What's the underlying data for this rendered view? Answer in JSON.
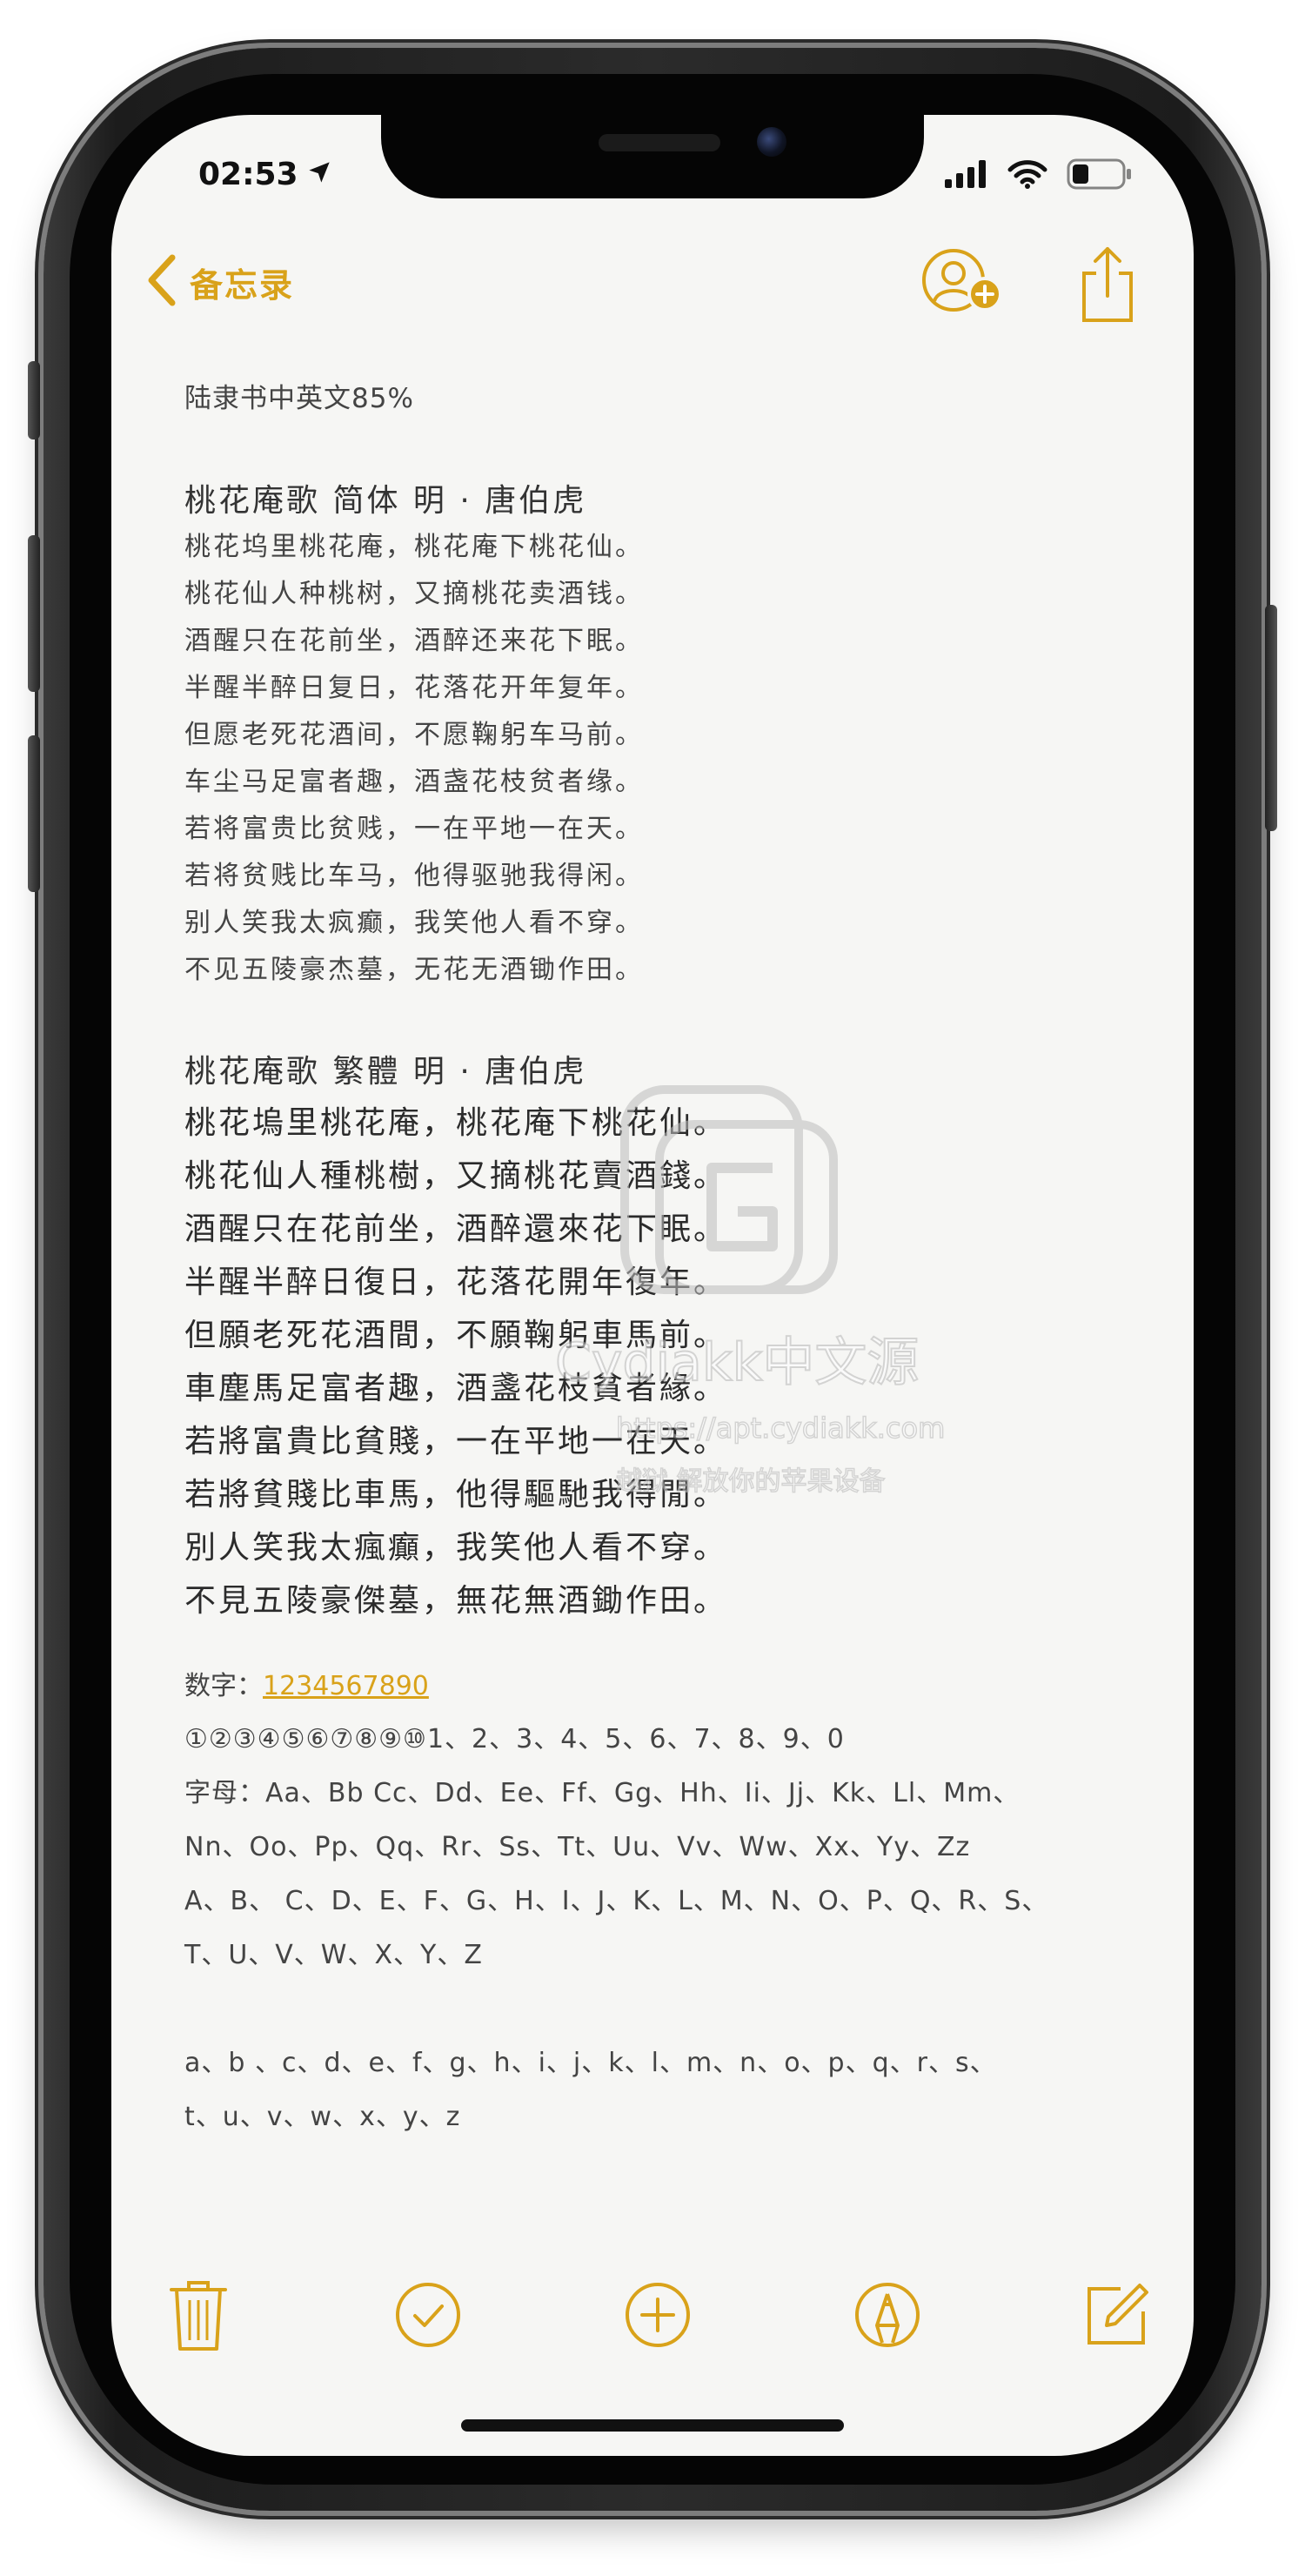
{
  "status_bar": {
    "time": "02:53"
  },
  "nav": {
    "back_label": "备忘录"
  },
  "note": {
    "font_note": "陆隶书中英文85%",
    "poem_simplified": {
      "title": "桃花庵歌  简体   明 · 唐伯虎",
      "lines": [
        "桃花坞里桃花庵，桃花庵下桃花仙。",
        "桃花仙人种桃树，又摘桃花卖酒钱。",
        "酒醒只在花前坐，酒醉还来花下眠。",
        "半醒半醉日复日，花落花开年复年。",
        "但愿老死花酒间，不愿鞠躬车马前。",
        "车尘马足富者趣，酒盏花枝贫者缘。",
        "若将富贵比贫贱，一在平地一在天。",
        "若将贫贱比车马，他得驱驰我得闲。",
        "别人笑我太疯癫，我笑他人看不穿。",
        "不见五陵豪杰墓，无花无酒锄作田。"
      ]
    },
    "poem_traditional": {
      "title": "桃花庵歌  繁體      明 · 唐伯虎",
      "lines": [
        "桃花塢里桃花庵，桃花庵下桃花仙。",
        "桃花仙人種桃樹，又摘桃花賣酒錢。",
        "酒醒只在花前坐，酒醉還來花下眠。",
        "半醒半醉日復日，花落花開年復年。",
        "但願老死花酒間，不願鞠躬車馬前。",
        "車塵馬足富者趣，酒盞花枝貧者緣。",
        "若將富貴比貧賤，一在平地一在天。",
        "若將貧賤比車馬，他得驅馳我得閒。",
        "別人笑我太瘋癲，我笑他人看不穿。",
        "不見五陵豪傑墓，無花無酒鋤作田。"
      ]
    },
    "numbers_label": "数字：",
    "numbers_link": "1234567890",
    "circled_numbers": "①②③④⑤⑥⑦⑧⑨⑩1、2、3、4、5、6、7、8、9、0",
    "letters_line_1": "字母：Aa、Bb Cc、Dd、Ee、Ff、Gg、Hh、Ii、Jj、Kk、Ll、Mm、",
    "letters_line_2": "Nn、Oo、Pp、Qq、Rr、Ss、Tt、Uu、Vv、Ww、Xx、Yy、Zz",
    "upper_line_1": "A、B、 C、D、E、F、G、H、I、J、K、L、M、N、O、P、Q、R、S、",
    "upper_line_2": "T、U、V、W、X、Y、Z",
    "lower_line_1": "a、b 、c、d、e、f、g、h、i、j、k、l、m、n、o、p、q、r、s、",
    "lower_line_2": "t、u、v、w、x、y、z"
  },
  "watermark": {
    "title": "Cydiakk中文源",
    "url": "https://apt.cydiakk.com",
    "slogan": "越狱 解放你的苹果设备"
  },
  "icons": {
    "location": "location-arrow-icon",
    "signal": "cellular-signal-icon",
    "wifi": "wifi-icon",
    "battery": "battery-icon",
    "back": "chevron-left-icon",
    "add_person": "add-person-icon",
    "share": "share-icon",
    "trash": "trash-icon",
    "checklist": "checkmark-circle-icon",
    "add": "plus-circle-icon",
    "markup": "markup-pen-icon",
    "compose": "compose-icon"
  },
  "colors": {
    "accent": "#d9a21a",
    "background": "#f6f6f4",
    "text": "#2b2b2b"
  }
}
